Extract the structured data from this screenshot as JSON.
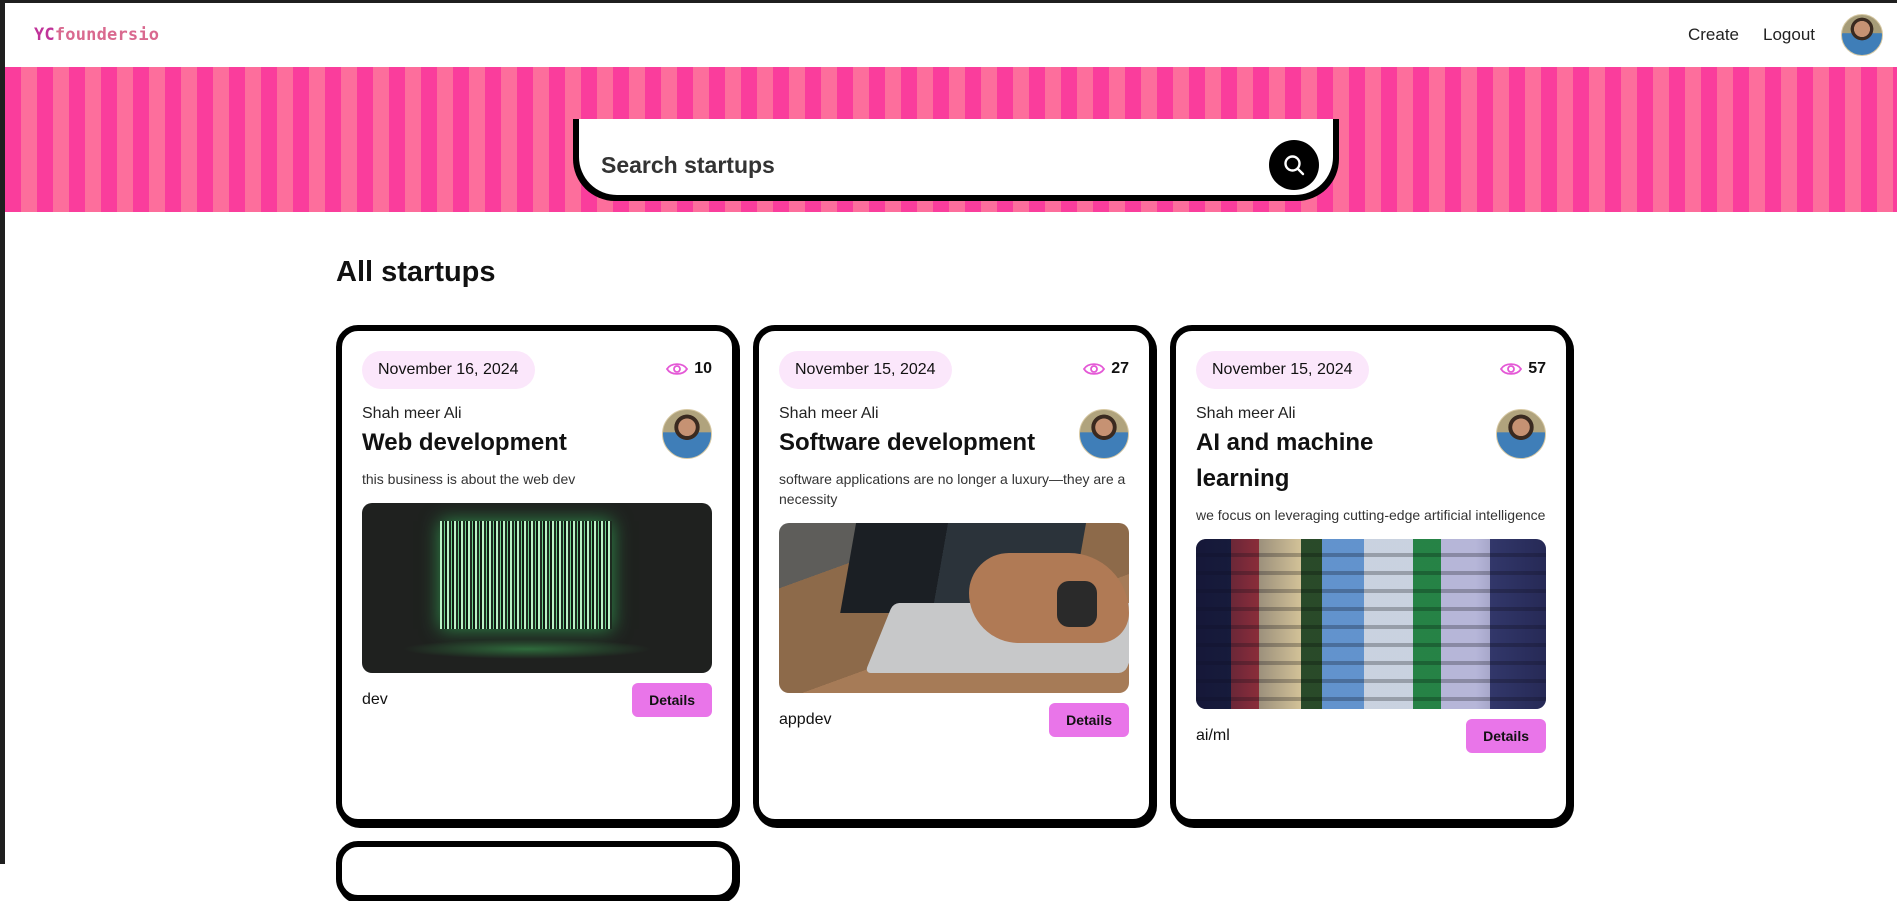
{
  "nav": {
    "brand_yc": "YC",
    "brand_rest": "foundersio",
    "links": [
      "Create",
      "Logout"
    ]
  },
  "search": {
    "placeholder": "Search startups"
  },
  "section": {
    "title": "All startups"
  },
  "cards": [
    {
      "date": "November 16, 2024",
      "views": "10",
      "author": "Shah meer Ali",
      "title": "Web development",
      "description": "this business is about the web dev",
      "category": "dev",
      "details_label": "Details"
    },
    {
      "date": "November 15, 2024",
      "views": "27",
      "author": "Shah meer Ali",
      "title": "Software development",
      "description": "software applications are no longer a luxury—they are a necessity",
      "category": "appdev",
      "details_label": "Details"
    },
    {
      "date": "November 15, 2024",
      "views": "57",
      "author": "Shah meer Ali",
      "title": "AI and machine learning",
      "description": "we focus on leveraging cutting-edge artificial intelligence",
      "category": "ai/ml",
      "details_label": "Details"
    }
  ],
  "colors": {
    "brand": "#c0349a",
    "stripe_a": "#fa3d9c",
    "stripe_b": "#fd6e9c",
    "pill_bg": "#fbe7fb",
    "button_bg": "#e975e9"
  }
}
